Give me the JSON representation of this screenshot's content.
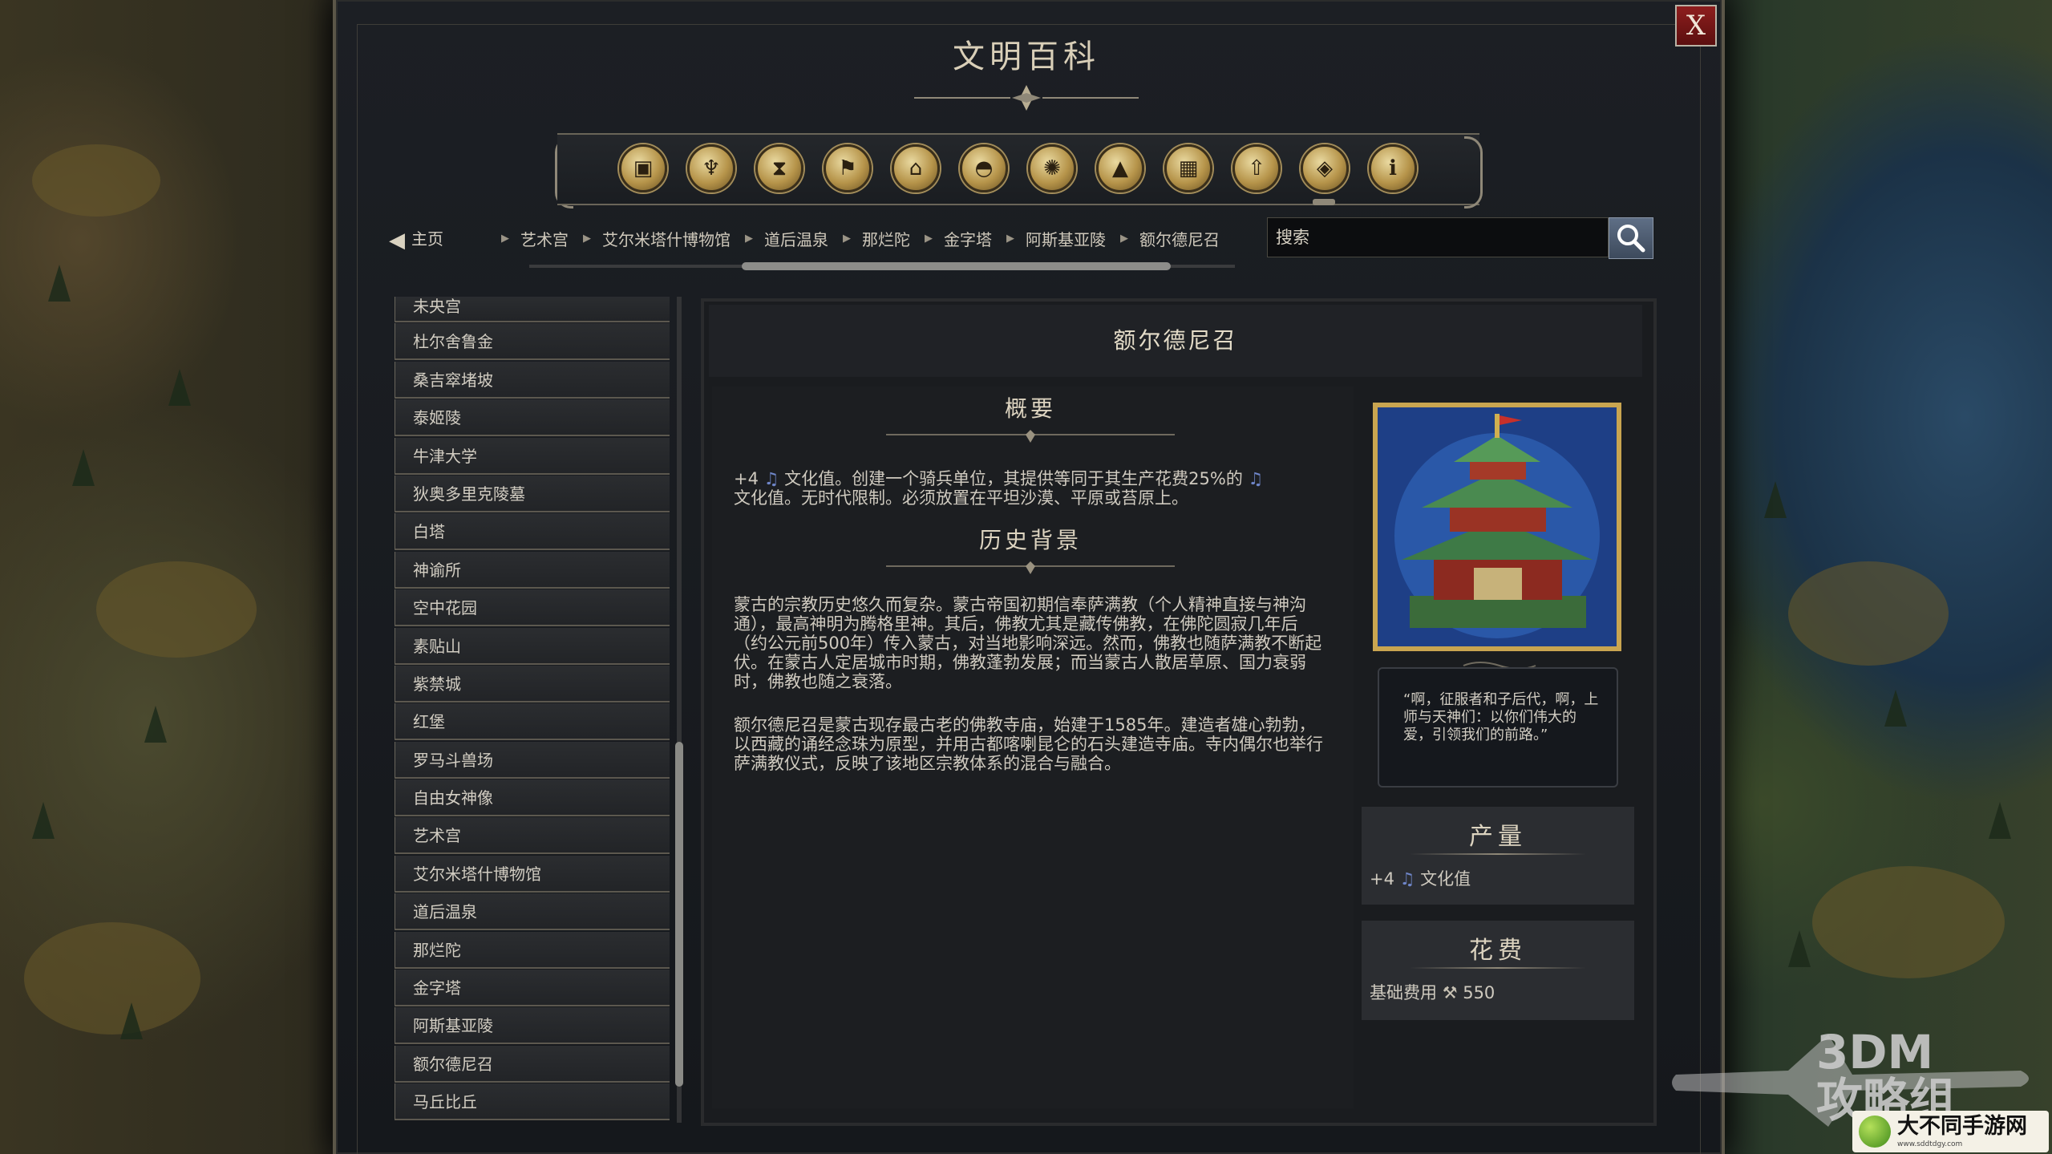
{
  "window": {
    "title": "文明百科",
    "close_label": "X"
  },
  "categories": [
    {
      "icon": "box-icon"
    },
    {
      "icon": "goblet-icon"
    },
    {
      "icon": "hourglass-icon"
    },
    {
      "icon": "flag-icon"
    },
    {
      "icon": "temple-icon"
    },
    {
      "icon": "dome-icon"
    },
    {
      "icon": "atom-icon"
    },
    {
      "icon": "mountain-icon"
    },
    {
      "icon": "building-icon"
    },
    {
      "icon": "up-arrow-icon"
    },
    {
      "icon": "book-icon"
    },
    {
      "icon": "info-icon"
    }
  ],
  "breadcrumb": {
    "home_label": "主页",
    "items": [
      "艺术宫",
      "艾尔米塔什博物馆",
      "道后温泉",
      "那烂陀",
      "金字塔",
      "阿斯基亚陵",
      "额尔德尼召"
    ]
  },
  "search": {
    "placeholder": "搜索"
  },
  "list": {
    "items": [
      "未央宫",
      "杜尔舍鲁金",
      "桑吉窣堵坡",
      "泰姬陵",
      "牛津大学",
      "狄奥多里克陵墓",
      "白塔",
      "神谕所",
      "空中花园",
      "素贴山",
      "紫禁城",
      "红堡",
      "罗马斗兽场",
      "自由女神像",
      "艺术宫",
      "艾尔米塔什博物馆",
      "道后温泉",
      "那烂陀",
      "金字塔",
      "阿斯基亚陵",
      "额尔德尼召",
      "马丘比丘"
    ]
  },
  "article": {
    "title": "额尔德尼召",
    "overview_heading": "概要",
    "overview_prefix": "+4",
    "overview_text_1": "文化值。创建一个骑兵单位，其提供等同于其生产花费25%的",
    "overview_text_2": "文化值。无时代限制。必须放置在平坦沙漠、平原或苔原上。",
    "history_heading": "历史背景",
    "history_p1": "蒙古的宗教历史悠久而复杂。蒙古帝国初期信奉萨满教（个人精神直接与神沟通），最高神明为腾格里神。其后，佛教尤其是藏传佛教，在佛陀圆寂几年后（约公元前500年）传入蒙古，对当地影响深远。然而，佛教也随萨满教不断起伏。在蒙古人定居城市时期，佛教蓬勃发展；而当蒙古人散居草原、国力衰弱时，佛教也随之衰落。",
    "history_p2": "额尔德尼召是蒙古现存最古老的佛教寺庙，始建于1585年。建造者雄心勃勃，以西藏的诵经念珠为原型，并用古都喀喇昆仑的石头建造寺庙。寺内偶尔也举行萨满教仪式，反映了该地区宗教体系的混合与融合。",
    "quote": "“啊，征服者和子后代，啊，上师与天神们：以你们伟大的爱，引领我们的前路。”"
  },
  "yield": {
    "heading": "产量",
    "amount": "+4",
    "label": "文化值"
  },
  "cost": {
    "heading": "花费",
    "label": "基础费用",
    "value": "550"
  },
  "watermarks": {
    "brand_line1": "3DM",
    "brand_line2": "攻略组",
    "site_name": "大不同手游网",
    "site_url": "www.sddtdgy.com"
  },
  "colors": {
    "accent_gold": "#c9a550",
    "culture_note": "#6f86c9",
    "close_red": "#8e1e1e"
  }
}
